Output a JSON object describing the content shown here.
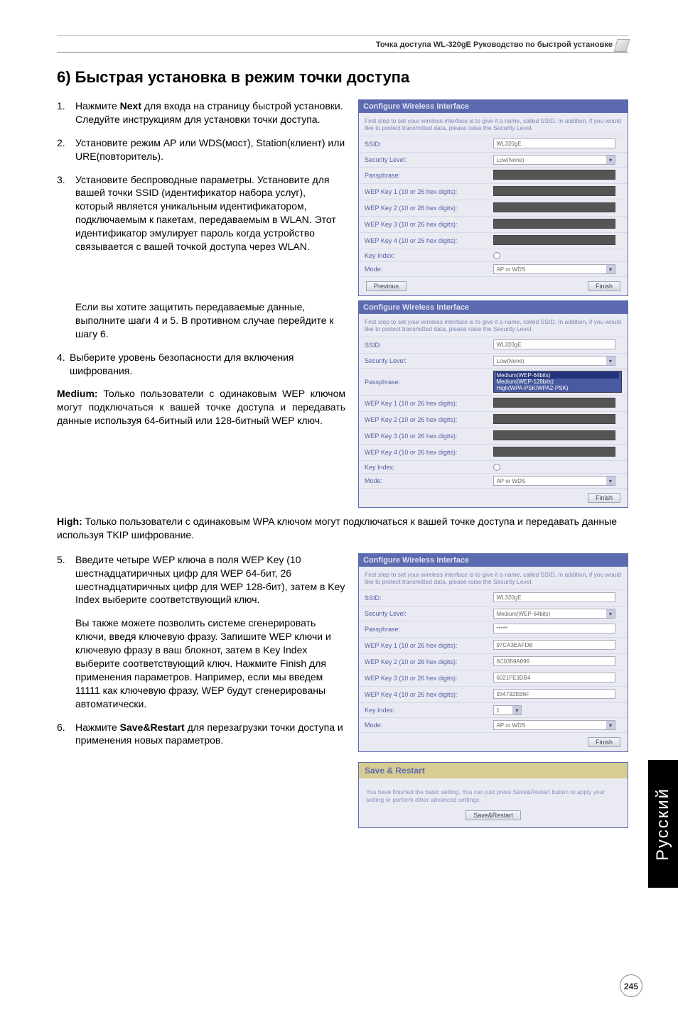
{
  "header": {
    "product_line": "Точка доступа WL-320gE Руководство по быстрой установке"
  },
  "section_title": "6) Быстрая установка в режим точки доступа",
  "steps": {
    "s1": {
      "num": "1.",
      "text_a": "Нажмите ",
      "bold": "Next",
      "text_b": " для входа на страницу быстрой установки. Следуйте инструкциям для установки точки доступа."
    },
    "s2": {
      "num": "2.",
      "text": "Установите режим AP или WDS(мост), Station(клиент) или URE(повторитель)."
    },
    "s3": {
      "num": "3.",
      "text": "Установите беспроводные параметры. Установите для вашей точки SSID (идентификатор набора услуг), который является уникальным идентификатором, подключаемым к пакетам, передаваемым в WLAN. Этот идентификатор эмулирует пароль когда устройство связывается с вашей точкой доступа через WLAN."
    },
    "s3_extra": "Если вы хотите защитить передаваемые данные,  выполните шаги 4 и 5. В противном случае перейдите к шагу 6.",
    "s4": {
      "num": "4.",
      "text": "Выберите уровень безопасности для включения шифрования."
    },
    "medium_label": "Medium:",
    "medium_text": " Только пользователи с одинаковым WEP ключом могут подключаться к вашей точке доступа и передавать данные используя 64-битный или 128-битный WEP ключ.",
    "high_label": "High:",
    "high_text": " Только пользователи с одинаковым WPA ключом могут подключаться к вашей точке доступа и передавать данные используя  TKIP шифрование.",
    "s5": {
      "num": "5.",
      "text": "Введите четыре WEP ключа в поля WEP Key (10 шестнадцатиричных цифр для WEP 64-бит, 26 шестнадцатиричных цифр для WEP 128-бит), затем в Key Index выберите соответствующий ключ."
    },
    "s5_extra": " Вы также можете позволить системе сгенерировать ключи, введя ключевую фразу. Запишите WEP ключи и ключевую фразу в ваш блокнот, затем в Key Index выберите соответствующий ключ. Нажмите  Finish для применения параметров. Например, если мы  введем 11111 как ключевую фразу,   WEP будут сгенерированы автоматически.",
    "s6": {
      "num": "6.",
      "text_a": "Нажмите ",
      "bold": "Save&Restart",
      "text_b": " для перезагрузки точки доступа и применения новых параметров."
    }
  },
  "panel1": {
    "title": "Configure Wireless Interface",
    "desc": "First step to set your wireless interface is to give it a name, called SSID. In addition, if you would like to protect transmitted data, please raise the Security Level.",
    "rows": {
      "ssid_lab": "SSID:",
      "ssid_val": "WL320gE",
      "sec_lab": "Security Level:",
      "sec_val": "Low(None)",
      "pass_lab": "Passphrase:",
      "k1_lab": "WEP Key 1 (10 or 26 hex digits):",
      "k2_lab": "WEP Key 2 (10 or 26 hex digits):",
      "k3_lab": "WEP Key 3 (10 or 26 hex digits):",
      "k4_lab": "WEP Key 4 (10 or 26 hex digits):",
      "ki_lab": "Key Index:",
      "mode_lab": "Mode:",
      "mode_val": "AP or WDS"
    },
    "btn_prev": "Previous",
    "btn_fin": "Finish"
  },
  "panel2": {
    "title": "Configure Wireless Interface",
    "desc": "First step to set your wireless interface is to give it a name, called SSID. In addition, if you would like to protect transmitted data, please raise the Security Level.",
    "rows": {
      "ssid_lab": "SSID:",
      "ssid_val": "WL320gE",
      "sec_lab": "Security Level:",
      "sec_val": "Low(None)",
      "pass_lab": "Passphrase:",
      "pass_opt1": "Medium(WEP-64bits)",
      "pass_opt2": "Medium(WEP-128bits)",
      "pass_opt3": "High(WPA-PSK/WPA2-PSK)",
      "k1_lab": "WEP Key 1 (10 or 26 hex digits):",
      "k2_lab": "WEP Key 2 (10 or 26 hex digits):",
      "k3_lab": "WEP Key 3 (10 or 26 hex digits):",
      "k4_lab": "WEP Key 4 (10 or 26 hex digits):",
      "ki_lab": "Key Index:",
      "mode_lab": "Mode:",
      "mode_val": "AP or WDS"
    },
    "btn_fin": "Finish"
  },
  "panel3": {
    "title": "Configure Wireless Interface",
    "desc": "First step to set your wireless interface is to give it a name, called SSID. In addition, if you would like to protect transmitted data, please raise the Security Level.",
    "rows": {
      "ssid_lab": "SSID:",
      "ssid_val": "WL320gE",
      "sec_lab": "Security Level:",
      "sec_val": "Medium(WEP-64bits)",
      "pass_lab": "Passphrase:",
      "pass_val": "*****",
      "k1_lab": "WEP Key 1 (10 or 26 hex digits):",
      "k1_val": "97CA3EAFDB",
      "k2_lab": "WEP Key 2 (10 or 26 hex digits):",
      "k2_val": "6C0359A096",
      "k3_lab": "WEP Key 3 (10 or 26 hex digits):",
      "k3_val": "6021FE3DB4",
      "k4_lab": "WEP Key 4 (10 or 26 hex digits):",
      "k4_val": "934792EB6F",
      "ki_lab": "Key Index:",
      "ki_val": "1",
      "mode_lab": "Mode:",
      "mode_val": "AP or WDS"
    },
    "btn_fin": "Finish"
  },
  "save_panel": {
    "title": "Save & Restart",
    "text": "You have finished the basic setting. You can just press Save&Restart button to apply your setting or perform other advanced settings.",
    "btn": "Save&Restart"
  },
  "side_tab": "Русский",
  "page_number": "245"
}
